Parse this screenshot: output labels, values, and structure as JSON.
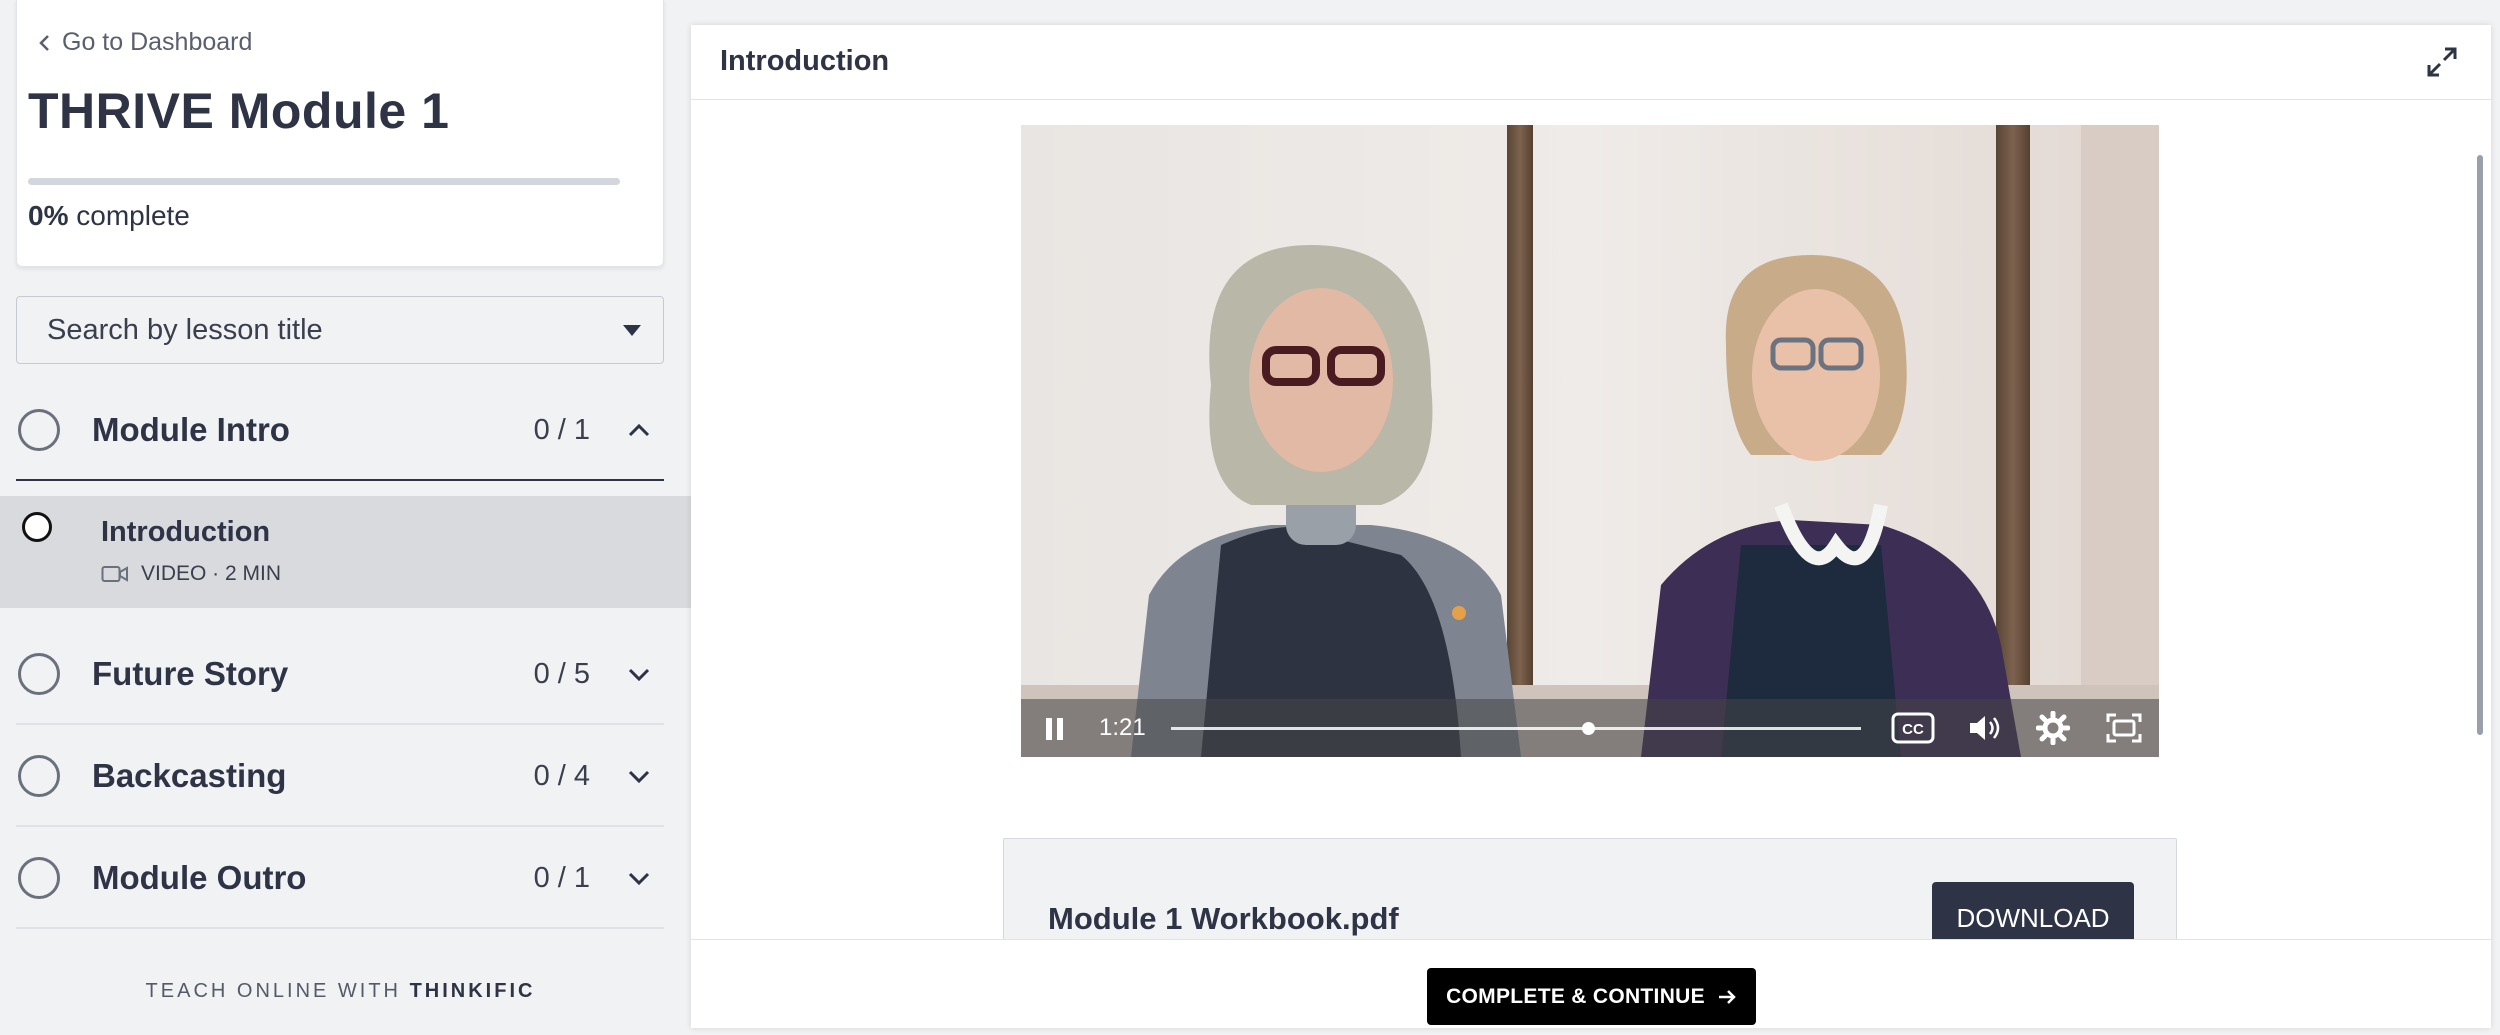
{
  "sidebar": {
    "back_link": "Go to Dashboard",
    "course_title": "THRIVE Module 1",
    "progress": {
      "percent_label": "0%",
      "suffix": "complete",
      "fraction": 0
    },
    "search": {
      "placeholder": "Search by lesson title"
    },
    "chapters": [
      {
        "title": "Module Intro",
        "count": "0 / 1",
        "expanded": true
      },
      {
        "title": "Future Story",
        "count": "0 / 5",
        "expanded": false
      },
      {
        "title": "Backcasting",
        "count": "0 / 4",
        "expanded": false
      },
      {
        "title": "Module Outro",
        "count": "0 / 1",
        "expanded": false
      }
    ],
    "active_lesson": {
      "title": "Introduction",
      "meta": "VIDEO · 2 MIN",
      "icon": "video-camera-icon"
    },
    "footer": {
      "prefix": "TEACH ONLINE WITH",
      "brand": "THINKIFIC"
    }
  },
  "main": {
    "title": "Introduction",
    "video": {
      "current_time": "1:21",
      "played_fraction": 0.605,
      "playing": true
    },
    "attachment": {
      "file_name": "Module 1 Workbook.pdf",
      "button_label": "DOWNLOAD"
    },
    "complete_button": "COMPLETE & CONTINUE"
  },
  "colors": {
    "primary": "#2f3346",
    "background": "#f1f2f4",
    "active_row": "#d8dade",
    "cta": "#000000"
  }
}
